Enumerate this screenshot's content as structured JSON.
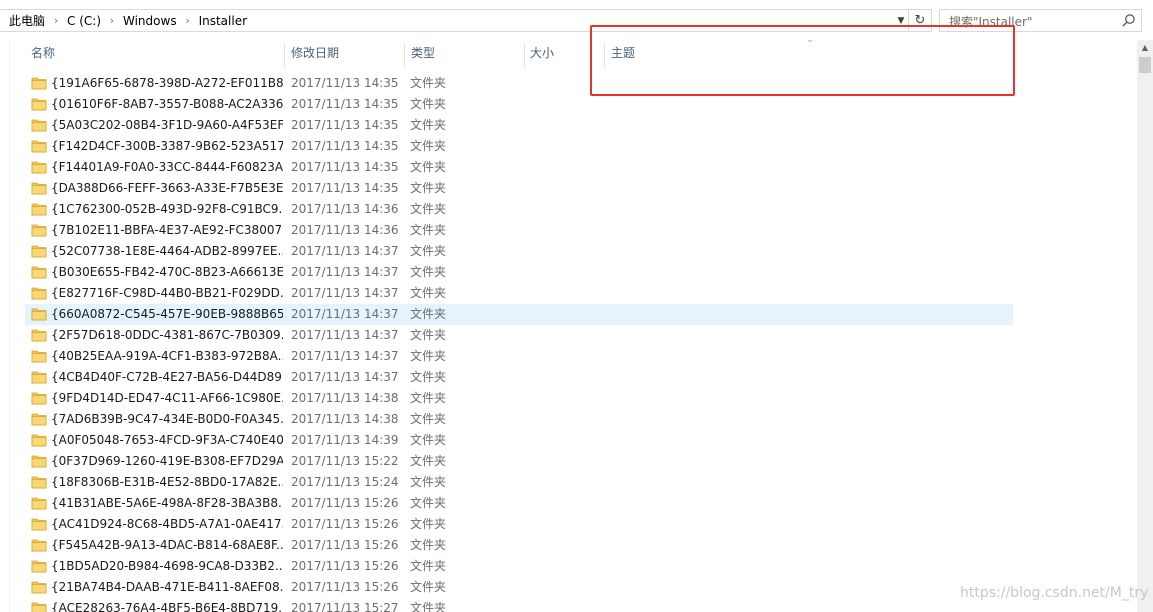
{
  "breadcrumbs": [
    "此电脑",
    "C (C:)",
    "Windows",
    "Installer"
  ],
  "search": {
    "placeholder": "搜索\"Installer\""
  },
  "columns": {
    "name": "名称",
    "modified": "修改日期",
    "type": "类型",
    "size": "大小",
    "subject": "主题"
  },
  "rows": [
    {
      "name": "{191A6F65-6878-398D-A272-EF011B8...",
      "date": "2017/11/13 14:35",
      "type": "文件夹"
    },
    {
      "name": "{01610F6F-8AB7-3557-B088-AC2A336...",
      "date": "2017/11/13 14:35",
      "type": "文件夹"
    },
    {
      "name": "{5A03C202-08B4-3F1D-9A60-A4F53EF...",
      "date": "2017/11/13 14:35",
      "type": "文件夹"
    },
    {
      "name": "{F142D4CF-300B-3387-9B62-523A517...",
      "date": "2017/11/13 14:35",
      "type": "文件夹"
    },
    {
      "name": "{F14401A9-F0A0-33CC-8444-F60823A...",
      "date": "2017/11/13 14:35",
      "type": "文件夹"
    },
    {
      "name": "{DA388D66-FEFF-3663-A33E-F7B5E3E...",
      "date": "2017/11/13 14:35",
      "type": "文件夹"
    },
    {
      "name": "{1C762300-052B-493D-92F8-C91BC9...",
      "date": "2017/11/13 14:36",
      "type": "文件夹"
    },
    {
      "name": "{7B102E11-BBFA-4E37-AE92-FC38007...",
      "date": "2017/11/13 14:36",
      "type": "文件夹"
    },
    {
      "name": "{52C07738-1E8E-4464-ADB2-8997EE...",
      "date": "2017/11/13 14:37",
      "type": "文件夹"
    },
    {
      "name": "{B030E655-FB42-470C-8B23-A66613E...",
      "date": "2017/11/13 14:37",
      "type": "文件夹"
    },
    {
      "name": "{E827716F-C98D-44B0-BB21-F029DD...",
      "date": "2017/11/13 14:37",
      "type": "文件夹"
    },
    {
      "name": "{660A0872-C545-457E-90EB-9888B65...",
      "date": "2017/11/13 14:37",
      "type": "文件夹",
      "selected": true
    },
    {
      "name": "{2F57D618-0DDC-4381-867C-7B0309...",
      "date": "2017/11/13 14:37",
      "type": "文件夹"
    },
    {
      "name": "{40B25EAA-919A-4CF1-B383-972B8A...",
      "date": "2017/11/13 14:37",
      "type": "文件夹"
    },
    {
      "name": "{4CB4D40F-C72B-4E27-BA56-D44D89...",
      "date": "2017/11/13 14:37",
      "type": "文件夹"
    },
    {
      "name": "{9FD4D14D-ED47-4C11-AF66-1C980E...",
      "date": "2017/11/13 14:38",
      "type": "文件夹"
    },
    {
      "name": "{7AD6B39B-9C47-434E-B0D0-F0A345...",
      "date": "2017/11/13 14:38",
      "type": "文件夹"
    },
    {
      "name": "{A0F05048-7653-4FCD-9F3A-C740E40...",
      "date": "2017/11/13 14:39",
      "type": "文件夹"
    },
    {
      "name": "{0F37D969-1260-419E-B308-EF7D29A...",
      "date": "2017/11/13 15:22",
      "type": "文件夹"
    },
    {
      "name": "{18F8306B-E31B-4E52-8BD0-17A82E...",
      "date": "2017/11/13 15:24",
      "type": "文件夹"
    },
    {
      "name": "{41B31ABE-5A6E-498A-8F28-3BA3B8...",
      "date": "2017/11/13 15:26",
      "type": "文件夹"
    },
    {
      "name": "{AC41D924-8C68-4BD5-A7A1-0AE417...",
      "date": "2017/11/13 15:26",
      "type": "文件夹"
    },
    {
      "name": "{F545A42B-9A13-4DAC-B814-68AE8F...",
      "date": "2017/11/13 15:26",
      "type": "文件夹"
    },
    {
      "name": "{1BD5AD20-B984-4698-9CA8-D33B2...",
      "date": "2017/11/13 15:26",
      "type": "文件夹"
    },
    {
      "name": "{21BA74B4-DAAB-471E-B411-8AEF08...",
      "date": "2017/11/13 15:26",
      "type": "文件夹"
    },
    {
      "name": "{ACE28263-76A4-4BF5-B6E4-8BD719...",
      "date": "2017/11/13 15:27",
      "type": "文件夹"
    }
  ],
  "colors": {
    "selection": "#e5f3ff",
    "folder": "#f3c54e",
    "highlight": "#e8322f",
    "header_text": "#4c607a"
  },
  "icons": {
    "folder": "folder-icon",
    "search": "search-icon",
    "refresh": "refresh-icon",
    "dropdown": "chevron-down-icon",
    "breadcrumb_sep": "chevron-right-icon"
  },
  "watermark": "https://blog.csdn.net/M_try"
}
